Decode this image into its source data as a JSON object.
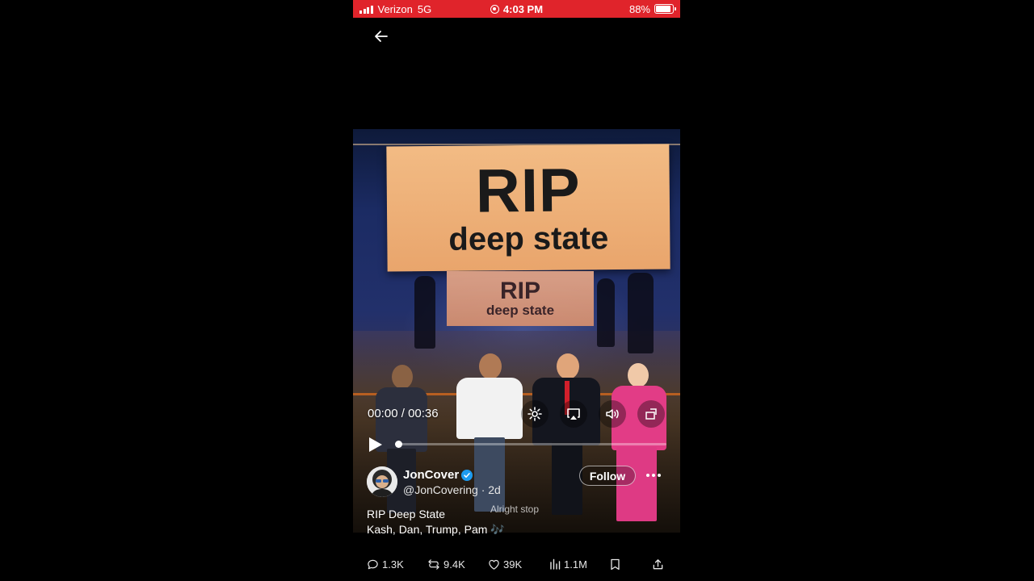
{
  "status_bar": {
    "carrier": "Verizon",
    "network": "5G",
    "time": "4:03 PM",
    "battery": "88%",
    "battery_level": 0.88,
    "background_color": "#e0242b"
  },
  "video": {
    "banner_top": "RIP",
    "banner_bottom": "deep state",
    "banner_back_top": "RIP",
    "banner_back_bottom": "deep state",
    "current_time": "00:00",
    "separator": " / ",
    "duration": "00:36",
    "progress": 0.0,
    "subtitle": "Alright stop"
  },
  "author": {
    "name": "JonCover",
    "handle": "@JonCovering",
    "age": " · 2d",
    "follow_label": "Follow",
    "verified_color": "#1d9bf0"
  },
  "tweet": {
    "line1": "RIP Deep State",
    "line2": "Kash, Dan, Trump, Pam 🎶"
  },
  "actions": {
    "replies": "1.3K",
    "reposts": "9.4K",
    "likes": "39K",
    "views": "1.1M"
  }
}
